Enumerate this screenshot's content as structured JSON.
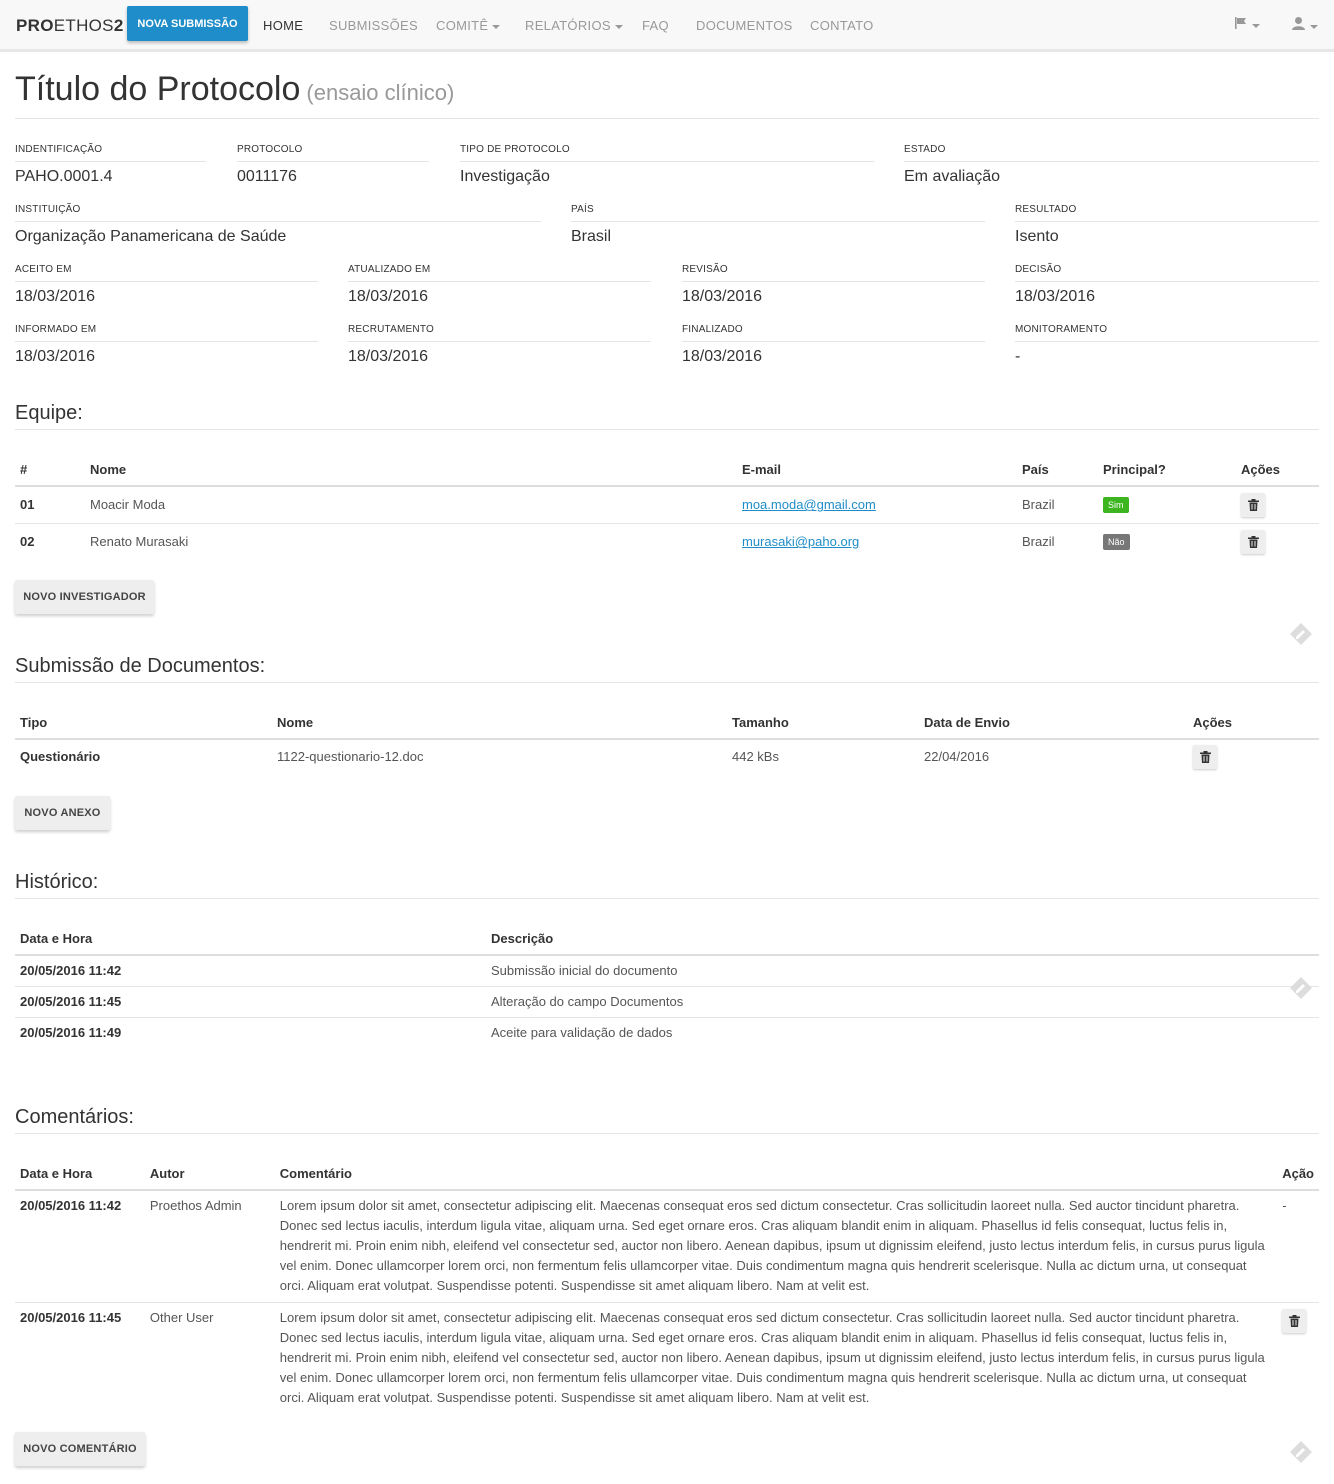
{
  "navbar": {
    "brand_bold": "PRO",
    "brand_thin": "ETHOS",
    "brand_num": "2",
    "new_submission": "NOVA SUBMISSÃO",
    "items": [
      {
        "label": "HOME",
        "active": true
      },
      {
        "label": "SUBMISSÕES"
      },
      {
        "label": "COMITÊ",
        "dropdown": true
      },
      {
        "label": "RELATÓRIOS",
        "dropdown": true
      },
      {
        "label": "FAQ"
      },
      {
        "label": "DOCUMENTOS"
      },
      {
        "label": "CONTATO"
      }
    ],
    "right_icons": [
      "flag-icon",
      "user-icon"
    ]
  },
  "title": {
    "main": "Título do Protocolo",
    "sub": "(ensaio clínico)"
  },
  "fields": {
    "identificacao": {
      "label": "INDENTIFICAÇÃO",
      "value": "PAHO.0001.4"
    },
    "protocolo": {
      "label": "PROTOCOLO",
      "value": "0011176"
    },
    "tipo": {
      "label": "TIPO DE PROTOCOLO",
      "value": "Investigação"
    },
    "estado": {
      "label": "ESTADO",
      "value": "Em avaliação"
    },
    "instituicao": {
      "label": "INSTITUIÇÃO",
      "value": "Organização Panamericana de Saúde"
    },
    "pais": {
      "label": "PAÍS",
      "value": "Brasil"
    },
    "resultado": {
      "label": "RESULTADO",
      "value": "Isento"
    },
    "aceito": {
      "label": "ACEITO EM",
      "value": "18/03/2016"
    },
    "atualizado": {
      "label": "ATUALIZADO EM",
      "value": "18/03/2016"
    },
    "revisao": {
      "label": "REVISÃO",
      "value": "18/03/2016"
    },
    "decisao": {
      "label": "DECISÃO",
      "value": "18/03/2016"
    },
    "informado": {
      "label": "INFORMADO EM",
      "value": "18/03/2016"
    },
    "recrutamento": {
      "label": "RECRUTAMENTO",
      "value": "18/03/2016"
    },
    "finalizado": {
      "label": "FINALIZADO",
      "value": "18/03/2016"
    },
    "monitoramento": {
      "label": "MONITORAMENTO",
      "value": "-"
    }
  },
  "equipe": {
    "title": "Equipe:",
    "headers": [
      "#",
      "Nome",
      "E-mail",
      "País",
      "Principal?",
      "Ações"
    ],
    "rows": [
      {
        "num": "01",
        "nome": "Moacir Moda",
        "email": "moa.moda@gmail.com",
        "pais": "Brazil",
        "principal": "Sim"
      },
      {
        "num": "02",
        "nome": "Renato Murasaki",
        "email": "murasaki@paho.org",
        "pais": "Brazil",
        "principal": "Não"
      }
    ],
    "button": "NOVO INVESTIGADOR"
  },
  "documentos": {
    "title": "Submissão de Documentos:",
    "headers": [
      "Tipo",
      "Nome",
      "Tamanho",
      "Data de Envio",
      "Ações"
    ],
    "rows": [
      {
        "tipo": "Questionário",
        "nome": "1122-questionario-12.doc",
        "tamanho": "442 kBs",
        "data": "22/04/2016"
      }
    ],
    "button": "NOVO ANEXO"
  },
  "historico": {
    "title": "Histórico:",
    "headers": [
      "Data e Hora",
      "Descrição"
    ],
    "rows": [
      {
        "data": "20/05/2016 11:42",
        "descricao": "Submissão inicial do documento"
      },
      {
        "data": "20/05/2016 11:45",
        "descricao": "Alteração do campo Documentos"
      },
      {
        "data": "20/05/2016 11:49",
        "descricao": "Aceite para validação de dados"
      }
    ]
  },
  "comentarios": {
    "title": "Comentários:",
    "headers": [
      "Data e Hora",
      "Autor",
      "Comentário",
      "Ação"
    ],
    "rows": [
      {
        "data": "20/05/2016 11:42",
        "autor": "Proethos Admin",
        "texto": "Lorem ipsum dolor sit amet, consectetur adipiscing elit. Maecenas consequat eros sed dictum consectetur. Cras sollicitudin laoreet nulla. Sed auctor tincidunt pharetra. Donec sed lectus iaculis, interdum ligula vitae, aliquam urna. Sed eget ornare eros. Cras aliquam blandit enim in aliquam. Phasellus id felis consequat, luctus felis in, hendrerit mi. Proin enim nibh, eleifend vel consectetur sed, auctor non libero. Aenean dapibus, ipsum ut dignissim eleifend, justo lectus interdum felis, in cursus purus ligula vel enim. Donec ullamcorper lorem orci, non fermentum felis ullamcorper vitae. Duis condimentum magna quis hendrerit scelerisque. Nulla ac dictum urna, ut consequat orci. Aliquam erat volutpat. Suspendisse potenti. Suspendisse sit amet aliquam libero. Nam at velit est.",
        "acao": "-"
      },
      {
        "data": "20/05/2016 11:45",
        "autor": "Other User",
        "texto": "Lorem ipsum dolor sit amet, consectetur adipiscing elit. Maecenas consequat eros sed dictum consectetur. Cras sollicitudin laoreet nulla. Sed auctor tincidunt pharetra. Donec sed lectus iaculis, interdum ligula vitae, aliquam urna. Sed eget ornare eros. Cras aliquam blandit enim in aliquam. Phasellus id felis consequat, luctus felis in, hendrerit mi. Proin enim nibh, eleifend vel consectetur sed, auctor non libero. Aenean dapibus, ipsum ut dignissim eleifend, justo lectus interdum felis, in cursus purus ligula vel enim. Donec ullamcorper lorem orci, non fermentum felis ullamcorper vitae. Duis condimentum magna quis hendrerit scelerisque. Nulla ac dictum urna, ut consequat orci. Aliquam erat volutpat. Suspendisse potenti. Suspendisse sit amet aliquam libero. Nam at velit est."
      }
    ],
    "button": "NOVO COMENTÁRIO"
  },
  "colors": {
    "primary": "#1f8dc9",
    "success": "#3cb521",
    "muted": "#777777"
  }
}
